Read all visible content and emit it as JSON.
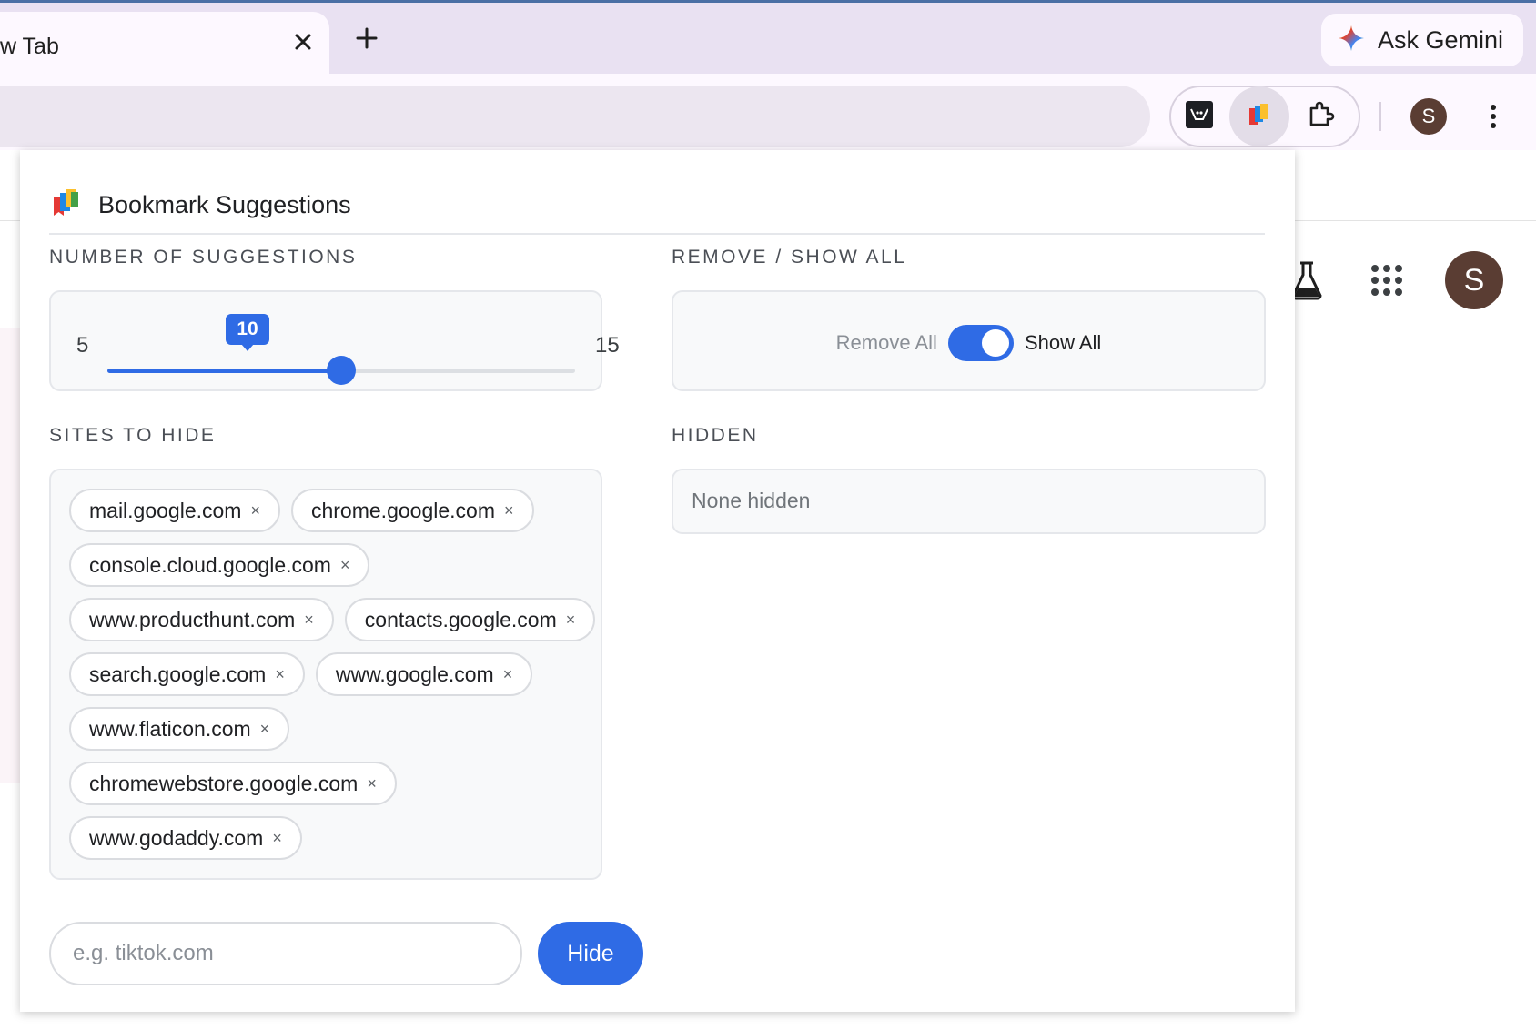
{
  "browser": {
    "tab_title": "w Tab",
    "tab_close_icon": "close-icon",
    "new_tab_icon": "plus-icon",
    "gemini_label": "Ask Gemini",
    "profile_initial": "S"
  },
  "page": {
    "profile_initial": "S"
  },
  "popup": {
    "title": "Bookmark Suggestions",
    "number_section": {
      "label": "NUMBER OF SUGGESTIONS",
      "min": "5",
      "max": "15",
      "value": "10",
      "fraction": 0.5
    },
    "remove_section": {
      "label": "REMOVE / SHOW ALL",
      "off_label": "Remove All",
      "on_label": "Show All",
      "toggle_on": true
    },
    "sites_section": {
      "label": "SITES TO HIDE",
      "sites": [
        "mail.google.com",
        "chrome.google.com",
        "console.cloud.google.com",
        "www.producthunt.com",
        "contacts.google.com",
        "search.google.com",
        "www.google.com",
        "www.flaticon.com",
        "chromewebstore.google.com",
        "www.godaddy.com"
      ],
      "remove_glyph": "×"
    },
    "hidden_section": {
      "label": "HIDDEN",
      "empty_text": "None hidden"
    },
    "input": {
      "placeholder": "e.g. tiktok.com",
      "value": ""
    },
    "hide_button": "Hide"
  },
  "colors": {
    "accent": "#2f6be5",
    "avatar": "#5a3d33"
  }
}
